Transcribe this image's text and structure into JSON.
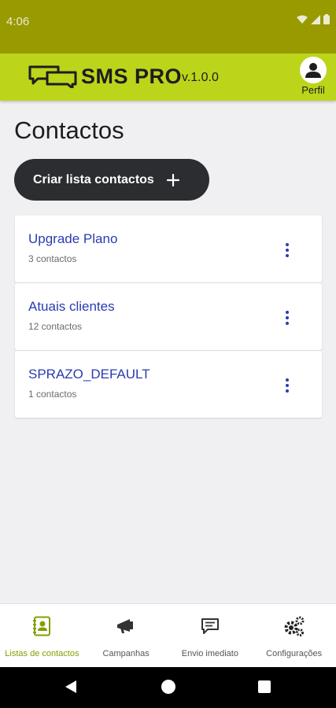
{
  "status_bar": {
    "time": "4:06"
  },
  "header": {
    "app_name": "SMS PRO",
    "version": "v.1.0.0",
    "profile_label": "Perfil",
    "accent_color": "#bcd51b"
  },
  "page": {
    "title": "Contactos"
  },
  "create_button": {
    "label": "Criar lista contactos",
    "icon": "plus-icon"
  },
  "lists": [
    {
      "name": "Upgrade Plano",
      "count": "3 contactos"
    },
    {
      "name": "Atuais clientes",
      "count": "12 contactos"
    },
    {
      "name": "SPRAZO_DEFAULT",
      "count": "1 contactos"
    }
  ],
  "bottom_nav": [
    {
      "label": "Listas de contactos",
      "icon": "contacts-book-icon",
      "active": true
    },
    {
      "label": "Campanhas",
      "icon": "megaphone-icon",
      "active": false
    },
    {
      "label": "Envio imediato",
      "icon": "message-icon",
      "active": false
    },
    {
      "label": "Configurações",
      "icon": "gears-icon",
      "active": false
    }
  ]
}
